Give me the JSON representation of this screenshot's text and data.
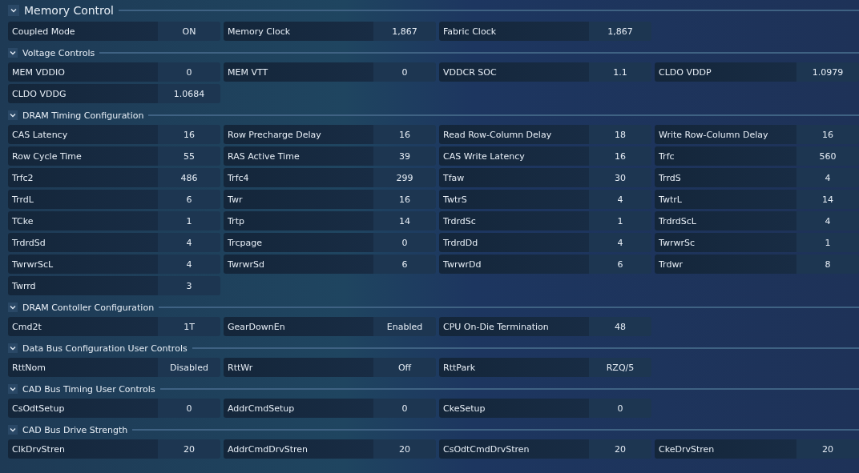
{
  "sections": [
    {
      "title": "Memory Control",
      "kind": "main",
      "expanded": true,
      "items": [
        {
          "label": "Coupled Mode",
          "value": "ON"
        },
        {
          "label": "Memory Clock",
          "value": "1,867"
        },
        {
          "label": "Fabric Clock",
          "value": "1,867"
        }
      ]
    },
    {
      "title": "Voltage Controls",
      "kind": "sub",
      "expanded": true,
      "items": [
        {
          "label": "MEM VDDIO",
          "value": "0"
        },
        {
          "label": "MEM VTT",
          "value": "0"
        },
        {
          "label": "VDDCR SOC",
          "value": "1.1"
        },
        {
          "label": "CLDO VDDP",
          "value": "1.0979"
        },
        {
          "label": "CLDO VDDG",
          "value": "1.0684"
        }
      ]
    },
    {
      "title": "DRAM Timing Configuration",
      "kind": "sub",
      "expanded": true,
      "items": [
        {
          "label": "CAS Latency",
          "value": "16"
        },
        {
          "label": "Row Precharge Delay",
          "value": "16"
        },
        {
          "label": "Read Row-Column Delay",
          "value": "18"
        },
        {
          "label": "Write Row-Column Delay",
          "value": "16"
        },
        {
          "label": "Row Cycle Time",
          "value": "55"
        },
        {
          "label": "RAS Active Time",
          "value": "39"
        },
        {
          "label": "CAS Write Latency",
          "value": "16"
        },
        {
          "label": "Trfc",
          "value": "560"
        },
        {
          "label": "Trfc2",
          "value": "486"
        },
        {
          "label": "Trfc4",
          "value": "299"
        },
        {
          "label": "Tfaw",
          "value": "30"
        },
        {
          "label": "TrrdS",
          "value": "4"
        },
        {
          "label": "TrrdL",
          "value": "6"
        },
        {
          "label": "Twr",
          "value": "16"
        },
        {
          "label": "TwtrS",
          "value": "4"
        },
        {
          "label": "TwtrL",
          "value": "14"
        },
        {
          "label": "TCke",
          "value": "1"
        },
        {
          "label": "Trtp",
          "value": "14"
        },
        {
          "label": "TrdrdSc",
          "value": "1"
        },
        {
          "label": "TrdrdScL",
          "value": "4"
        },
        {
          "label": "TrdrdSd",
          "value": "4"
        },
        {
          "label": "Trcpage",
          "value": "0"
        },
        {
          "label": "TrdrdDd",
          "value": "4"
        },
        {
          "label": "TwrwrSc",
          "value": "1"
        },
        {
          "label": "TwrwrScL",
          "value": "4"
        },
        {
          "label": "TwrwrSd",
          "value": "6"
        },
        {
          "label": "TwrwrDd",
          "value": "6"
        },
        {
          "label": "Trdwr",
          "value": "8"
        },
        {
          "label": "Twrrd",
          "value": "3"
        }
      ]
    },
    {
      "title": "DRAM Contoller Configuration",
      "kind": "sub",
      "expanded": true,
      "items": [
        {
          "label": "Cmd2t",
          "value": "1T"
        },
        {
          "label": "GearDownEn",
          "value": "Enabled"
        },
        {
          "label": "CPU On-Die Termination",
          "value": "48"
        }
      ]
    },
    {
      "title": "Data Bus Configuration User Controls",
      "kind": "sub",
      "expanded": true,
      "items": [
        {
          "label": "RttNom",
          "value": "Disabled"
        },
        {
          "label": "RttWr",
          "value": "Off"
        },
        {
          "label": "RttPark",
          "value": "RZQ/5"
        }
      ]
    },
    {
      "title": "CAD Bus Timing User Controls",
      "kind": "sub",
      "expanded": true,
      "items": [
        {
          "label": "CsOdtSetup",
          "value": "0"
        },
        {
          "label": "AddrCmdSetup",
          "value": "0"
        },
        {
          "label": "CkeSetup",
          "value": "0"
        }
      ]
    },
    {
      "title": "CAD Bus Drive Strength",
      "kind": "sub",
      "expanded": true,
      "items": [
        {
          "label": "ClkDrvStren",
          "value": "20"
        },
        {
          "label": "AddrCmdDrvStren",
          "value": "20"
        },
        {
          "label": "CsOdtCmdDrvStren",
          "value": "20"
        },
        {
          "label": "CkeDrvStren",
          "value": "20"
        }
      ]
    }
  ]
}
